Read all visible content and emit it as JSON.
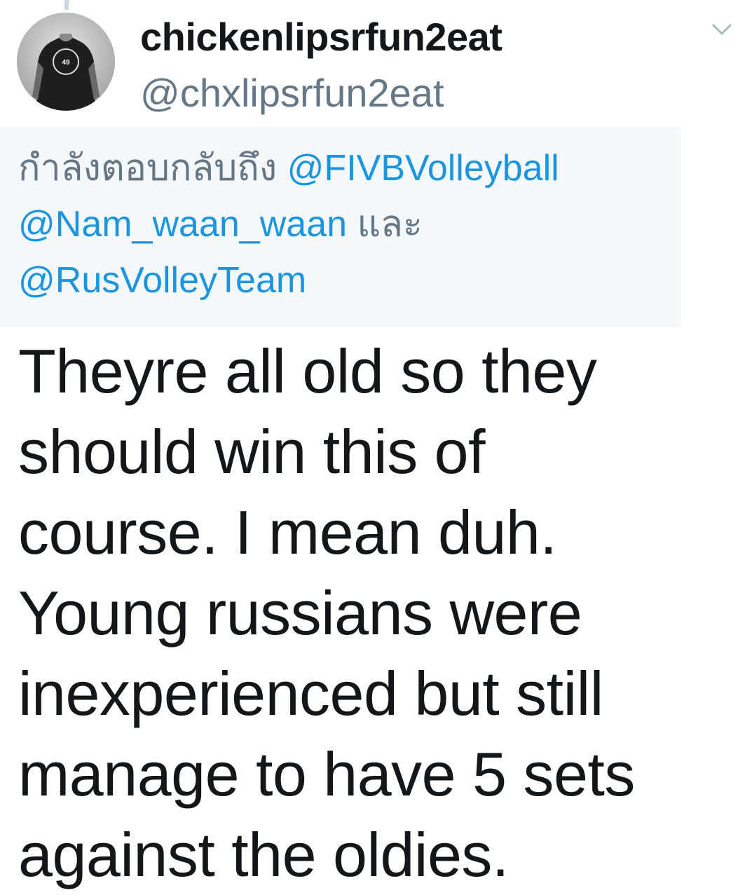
{
  "tweet": {
    "author": {
      "display_name": "chickenlipsrfun2eat",
      "handle": "@chxlipsrfun2eat",
      "avatar_icon": "avatar-photo"
    },
    "menu_icon": "chevron-down-icon",
    "reply_context": {
      "prefix": "กำลังตอบกลับถึง",
      "mentions": [
        "@FIVBVolleyball",
        "@Nam_waan_waan",
        "@RusVolleyTeam"
      ],
      "conjunction": "และ"
    },
    "text_lines": [
      "Theyre all old so they",
      "should win this of",
      "course. I mean duh.",
      "Young russians were",
      "inexperienced but still",
      "manage to have 5 sets",
      "against the oldies."
    ]
  },
  "colors": {
    "text_primary": "#14171a",
    "text_secondary": "#657786",
    "link": "#1b95e0",
    "reply_bg": "#f5f8fa"
  }
}
